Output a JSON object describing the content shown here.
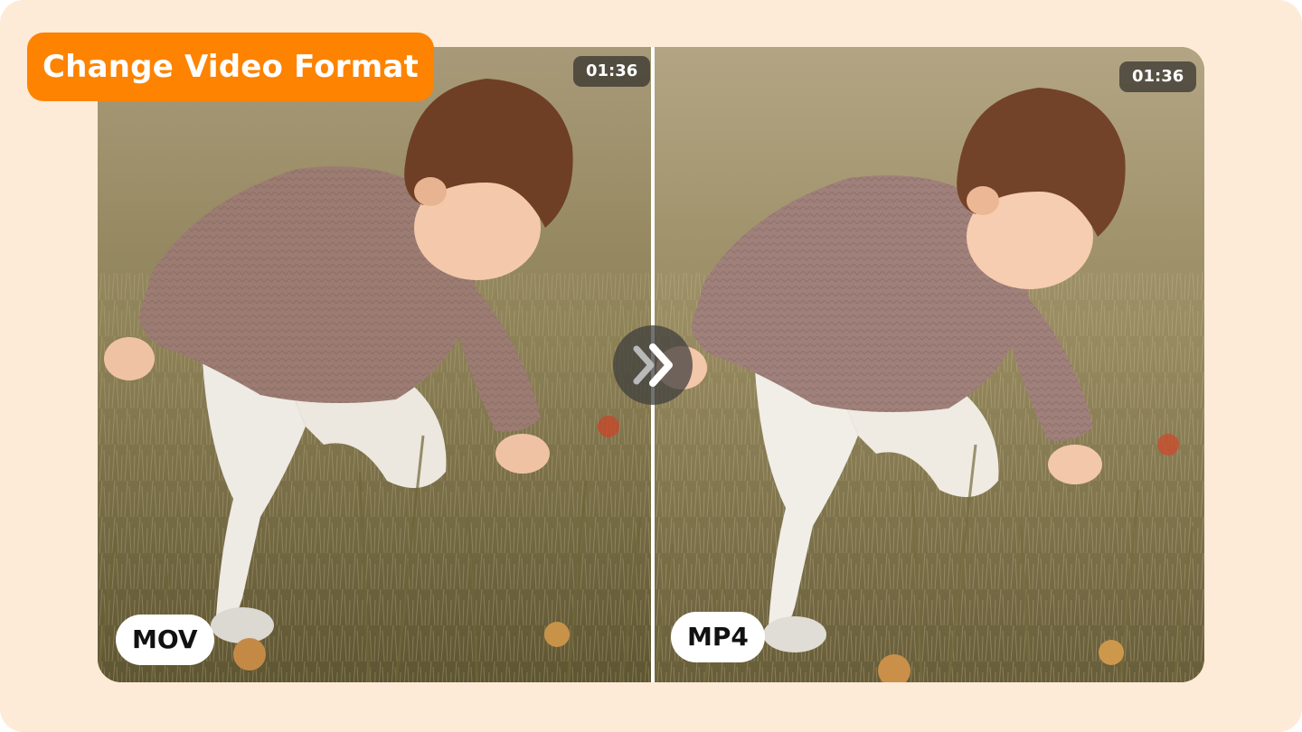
{
  "title": "Change Video Format",
  "comparison": {
    "before": {
      "format": "MOV",
      "duration": "01:36"
    },
    "after": {
      "format": "MP4",
      "duration": "01:36"
    }
  },
  "icons": {
    "convert": "double-chevron-right-icon"
  },
  "colors": {
    "background": "#fdebd8",
    "accent": "#fd8300",
    "pill": "#ffffff"
  }
}
